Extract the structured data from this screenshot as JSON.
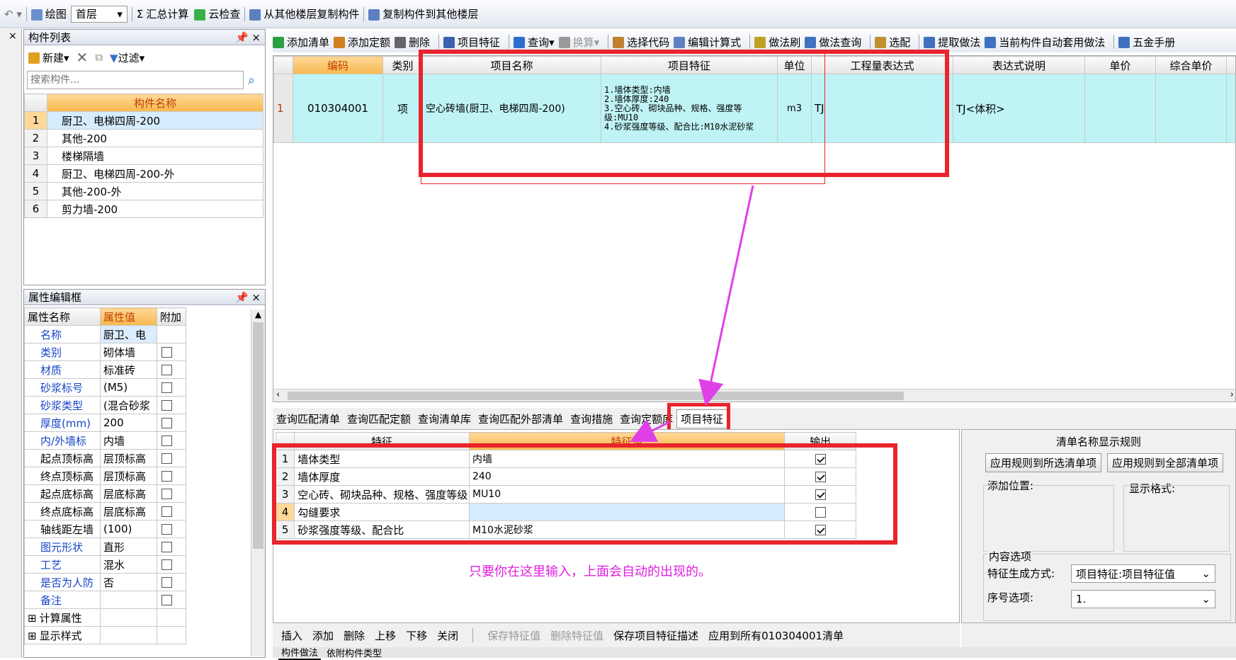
{
  "toolbar_top": {
    "draw_label": "绘图",
    "floor_value": "首层",
    "sum_label": "汇总计算",
    "cloud_label": "云检查",
    "copy_from_label": "从其他楼层复制构件",
    "copy_to_label": "复制构件到其他楼层"
  },
  "component_list": {
    "title": "构件列表",
    "new_label": "新建",
    "filter_label": "过滤",
    "search_placeholder": "搜索构件...",
    "header": "构件名称",
    "rows": [
      {
        "num": "1",
        "name": "厨卫、电梯四周-200"
      },
      {
        "num": "2",
        "name": "其他-200"
      },
      {
        "num": "3",
        "name": "楼梯隔墙"
      },
      {
        "num": "4",
        "name": "厨卫、电梯四周-200-外"
      },
      {
        "num": "5",
        "name": "其他-200-外"
      },
      {
        "num": "6",
        "name": "剪力墙-200"
      }
    ]
  },
  "property_editor": {
    "title": "属性编辑框",
    "col_name": "属性名称",
    "col_value": "属性值",
    "col_extra": "附加",
    "rows": [
      {
        "name": "名称",
        "value": "厨卫、电",
        "blue": true,
        "chk": "none"
      },
      {
        "name": "类别",
        "value": "砌体墙",
        "blue": true,
        "chk": "off"
      },
      {
        "name": "材质",
        "value": "标准砖",
        "blue": true,
        "chk": "off"
      },
      {
        "name": "砂浆标号",
        "value": "(M5)",
        "blue": true,
        "chk": "off"
      },
      {
        "name": "砂浆类型",
        "value": "(混合砂浆",
        "blue": true,
        "chk": "off"
      },
      {
        "name": "厚度(mm)",
        "value": "200",
        "blue": true,
        "chk": "off"
      },
      {
        "name": "内/外墙标",
        "value": "内墙",
        "blue": true,
        "chk": "off"
      },
      {
        "name": "起点顶标高",
        "value": "层顶标高",
        "blue": false,
        "chk": "off"
      },
      {
        "name": "终点顶标高",
        "value": "层顶标高",
        "blue": false,
        "chk": "off"
      },
      {
        "name": "起点底标高",
        "value": "层底标高",
        "blue": false,
        "chk": "off"
      },
      {
        "name": "终点底标高",
        "value": "层底标高",
        "blue": false,
        "chk": "off"
      },
      {
        "name": "轴线距左墙",
        "value": "(100)",
        "blue": false,
        "chk": "off"
      },
      {
        "name": "图元形状",
        "value": "直形",
        "blue": true,
        "chk": "off"
      },
      {
        "name": "工艺",
        "value": "混水",
        "blue": true,
        "chk": "off"
      },
      {
        "name": "是否为人防",
        "value": "否",
        "blue": true,
        "chk": "off"
      },
      {
        "name": "备注",
        "value": "",
        "blue": true,
        "chk": "off"
      },
      {
        "name": "计算属性",
        "value": "",
        "blue": false,
        "chk": "none",
        "expand": true
      },
      {
        "name": "显示样式",
        "value": "",
        "blue": false,
        "chk": "none",
        "expand": true
      }
    ]
  },
  "list_toolbar": [
    "添加清单",
    "添加定额",
    "删除",
    "项目特征",
    "查询",
    "换算",
    "选择代码",
    "编辑计算式",
    "做法刷",
    "做法查询",
    "选配",
    "提取做法",
    "当前构件自动套用做法",
    "五金手册"
  ],
  "main_grid": {
    "headers": [
      "编码",
      "类别",
      "项目名称",
      "项目特征",
      "单位",
      "工程量表达式",
      "表达式说明",
      "单价",
      "综合单价",
      "措"
    ],
    "row": {
      "num": "1",
      "code": "010304001",
      "type": "项",
      "name": "空心砖墙(厨卫、电梯四周-200)",
      "features": [
        "1.墙体类型:内墙",
        "2.墙体厚度:240",
        "3.空心砖、砌块品种、规格、强度等级:MU10",
        "4.砂浆强度等级、配合比:M10水泥砂浆"
      ],
      "unit": "m3",
      "expr": "TJ",
      "expr_desc": "TJ<体积>"
    }
  },
  "bottom_tabs": [
    "查询匹配清单",
    "查询匹配定额",
    "查询清单库",
    "查询匹配外部清单",
    "查询措施",
    "查询定额库",
    "项目特征"
  ],
  "feature_grid": {
    "col_feature": "特征",
    "col_value": "特征值",
    "col_output": "输出",
    "rows": [
      {
        "num": "1",
        "feature": "墙体类型",
        "value": "内墙",
        "out": true
      },
      {
        "num": "2",
        "feature": "墙体厚度",
        "value": "240",
        "out": true
      },
      {
        "num": "3",
        "feature": "空心砖、砌块品种、规格、强度等级",
        "value": "MU10",
        "out": true
      },
      {
        "num": "4",
        "feature": "勾缝要求",
        "value": "",
        "out": false
      },
      {
        "num": "5",
        "feature": "砂浆强度等级、配合比",
        "value": "M10水泥砂浆",
        "out": true
      }
    ]
  },
  "annotation": "只要你在这里输入，上面会自动的出现的。",
  "rules_panel": {
    "title": "清单名称显示规则",
    "apply_selected": "应用规则到所选清单项",
    "apply_all": "应用规则到全部清单项",
    "add_position": "添加位置:",
    "display_format": "显示格式:",
    "content_options": "内容选项",
    "gen_mode_label": "特征生成方式:",
    "gen_mode_value": "项目特征:项目特征值",
    "seq_label": "序号选项:",
    "seq_value": "1."
  },
  "feature_actions": [
    "插入",
    "添加",
    "删除",
    "上移",
    "下移",
    "关闭",
    "保存特征值",
    "删除特征值",
    "保存项目特征描述",
    "应用到所有010304001清单"
  ],
  "bottom_tab_strip": [
    "构件做法",
    "依附构件类型"
  ],
  "colors": {
    "accent_red": "#e8242c",
    "arrow_magenta": "#e040e8",
    "selected_row": "#bff3f5",
    "annotation": "#e020e0"
  }
}
